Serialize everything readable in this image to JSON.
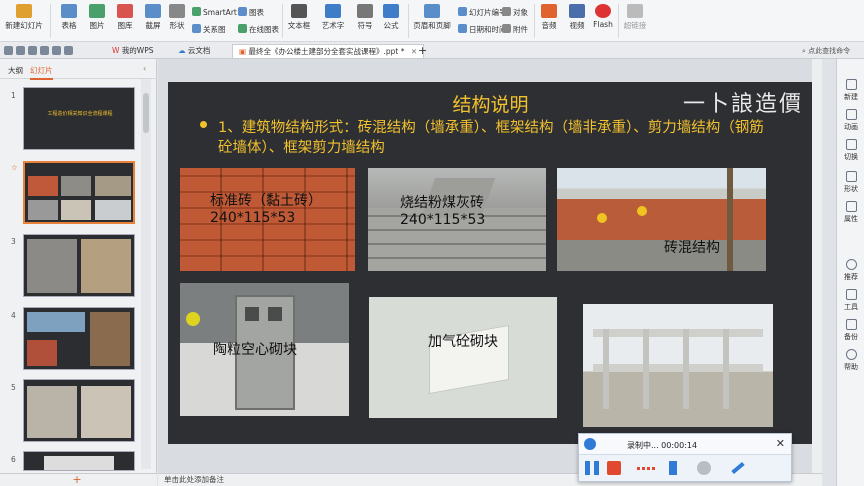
{
  "ribbon": {
    "buttons": [
      {
        "label": "新建幻灯片",
        "icon": "new-slide-icon",
        "color": "#e0a030"
      },
      {
        "label": "表格",
        "icon": "table-icon",
        "color": "#5b8dc9"
      },
      {
        "label": "图片",
        "icon": "picture-icon",
        "color": "#4aa06a"
      },
      {
        "label": "图库",
        "icon": "gallery-icon",
        "color": "#d9534f"
      },
      {
        "label": "截屏",
        "icon": "screenshot-icon",
        "color": "#5b8dc9"
      },
      {
        "label": "形状",
        "icon": "shape-icon",
        "color": "#888"
      },
      {
        "label": "文本框",
        "icon": "textbox-icon",
        "color": "#555"
      },
      {
        "label": "艺术字",
        "icon": "wordart-icon",
        "color": "#3f7dc9"
      },
      {
        "label": "符号",
        "icon": "symbol-icon",
        "color": "#777"
      },
      {
        "label": "公式",
        "icon": "formula-icon",
        "color": "#3f7dc9"
      },
      {
        "label": "页眉和页脚",
        "icon": "header-footer-icon",
        "color": "#5b8dc9"
      },
      {
        "label": "音频",
        "icon": "audio-icon",
        "color": "#e0632f"
      },
      {
        "label": "视频",
        "icon": "video-icon",
        "color": "#4a6ea9"
      },
      {
        "label": "Flash",
        "icon": "flash-icon",
        "color": "#d33"
      },
      {
        "label": "超链接",
        "icon": "hyperlink-icon",
        "color": "#999"
      }
    ],
    "small": {
      "smartart": "SmartArt",
      "chart": "图表",
      "online_chart": "在线图表",
      "relation": "关系图",
      "slide_number": "幻灯片编号",
      "object": "对象",
      "datetime": "日期和时间",
      "attachment": "附件"
    }
  },
  "tabs": {
    "wps": "我的WPS",
    "cloud": "云文档",
    "file": "最终全《办公楼土建部分全套实战课程》.ppt *",
    "add": "+",
    "search": "点此查找命令"
  },
  "left_panel": {
    "tab_outline": "大纲",
    "tab_slides": "幻灯片",
    "slide_numbers": [
      "1",
      "2",
      "3",
      "4",
      "5",
      "6"
    ],
    "slide1_title": "工程造价相关知识全流程课程",
    "add_button": "+"
  },
  "slide": {
    "title": "结构说明",
    "brand": "一卜誏造價",
    "body": "1、建筑物结构形式：砖混结构（墙承重）、框架结构（墙非承重）、剪力墙结构（钢筋砼墙体）、框架剪力墙结构",
    "captions": {
      "brick1": "标准砖（黏土砖）",
      "brick1_size": "240*115*53",
      "brick2": "烧结粉煤灰砖",
      "brick2_size": "240*115*53",
      "masonry": "砖混结构",
      "hollow": "陶粒空心砌块",
      "aerated": "加气砼砌块"
    }
  },
  "notes": {
    "placeholder": "单击此处添加备注"
  },
  "right_bar": {
    "items": [
      "新建",
      "动画",
      "切换",
      "形状",
      "属性",
      "推荐",
      "工具",
      "备份",
      "帮助"
    ]
  },
  "recorder": {
    "status": "录制中...  00:00:14",
    "close": "✕"
  }
}
